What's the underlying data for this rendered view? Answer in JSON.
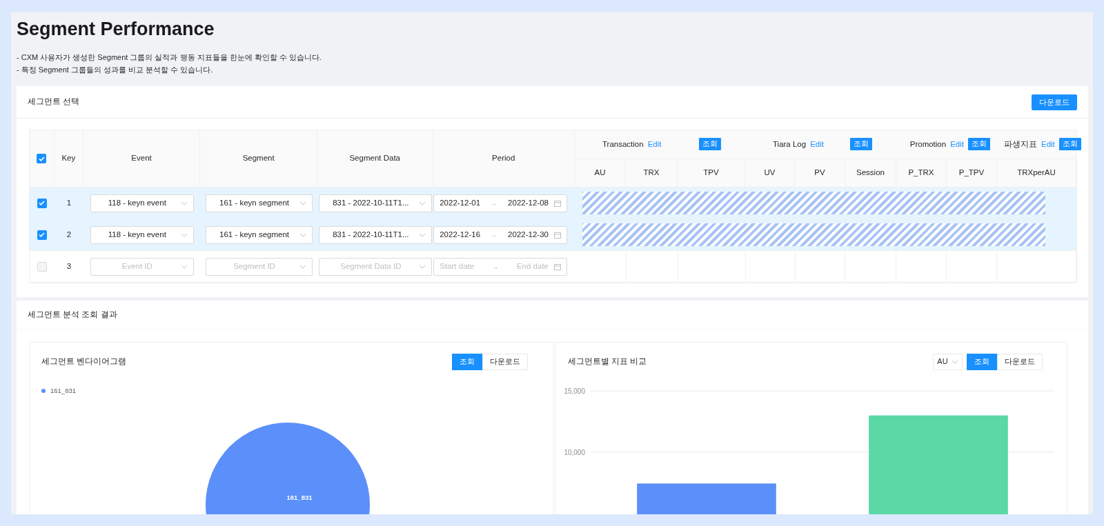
{
  "page": {
    "title": "Segment Performance",
    "description": [
      "- CXM 사용자가 생성한 Segment 그룹의 실적과 행동 지표들을 한눈에 확인할 수 있습니다.",
      "- 특정 Segment 그룹들의 성과를 비교 분석할 수 있습니다."
    ]
  },
  "selection_card": {
    "title": "세그먼트 선택",
    "download_button": "다운로드",
    "table": {
      "header_checked": true,
      "columns": [
        "Key",
        "Event",
        "Segment",
        "Segment Data",
        "Period"
      ],
      "metric_groups": [
        {
          "label": "Transaction",
          "edit": "Edit",
          "query": "조회",
          "metrics": [
            "AU",
            "TRX",
            "TPV"
          ]
        },
        {
          "label": "Tiara Log",
          "edit": "Edit",
          "query": "조회",
          "metrics": [
            "UV",
            "PV",
            "Session"
          ]
        },
        {
          "label": "Promotion",
          "edit": "Edit",
          "query": "조회",
          "metrics": [
            "P_TRX",
            "P_TPV"
          ]
        },
        {
          "label": "파생지표",
          "edit": "Edit",
          "query": "조회",
          "metrics": [
            "TRXperAU"
          ]
        }
      ],
      "rows": [
        {
          "key": "1",
          "checked": true,
          "loading": true,
          "event": {
            "value": "118 - keyn event"
          },
          "segment": {
            "value": "161 - keyn segment"
          },
          "segment_data": {
            "value": "831 - 2022-10-11T1..."
          },
          "period": {
            "separator": "→",
            "start": {
              "value": "2022-12-01"
            },
            "end": {
              "value": "2022-12-08"
            }
          }
        },
        {
          "key": "2",
          "checked": true,
          "loading": true,
          "event": {
            "value": "118 - keyn event"
          },
          "segment": {
            "value": "161 - keyn segment"
          },
          "segment_data": {
            "value": "831 - 2022-10-11T1..."
          },
          "period": {
            "separator": "→",
            "start": {
              "value": "2022-12-16"
            },
            "end": {
              "value": "2022-12-30"
            }
          }
        },
        {
          "key": "3",
          "checked": false,
          "loading": false,
          "event": {
            "placeholder": "Event ID"
          },
          "segment": {
            "placeholder": "Segment ID"
          },
          "segment_data": {
            "placeholder": "Segment Data ID"
          },
          "period": {
            "separator": "→",
            "start": {
              "placeholder": "Start date"
            },
            "end": {
              "placeholder": "End date"
            }
          }
        }
      ]
    }
  },
  "result_card": {
    "title": "세그먼트 분석 조회 결과",
    "venn_panel": {
      "title": "세그먼트 벤다이어그램",
      "buttons": [
        {
          "label": "조회",
          "selected": true
        },
        {
          "label": "다운로드",
          "selected": false
        }
      ],
      "legend": [
        {
          "label": "161_831",
          "color": "#5b8ff9"
        }
      ],
      "circle_label": "161_831"
    },
    "compare_panel": {
      "title": "세그먼트별 지표 비교",
      "metric_select": {
        "value": "AU"
      },
      "buttons": [
        {
          "label": "조회",
          "selected": true
        },
        {
          "label": "다운로드",
          "selected": false
        }
      ],
      "chart_data": {
        "type": "bar",
        "ylim": [
          0,
          15000
        ],
        "yticks": [
          {
            "value": 10000,
            "label": "10,000"
          },
          {
            "value": 15000,
            "label": "15,000"
          }
        ],
        "series": [
          {
            "color": "#5b8ff9",
            "values": [
              7450,
              null
            ]
          },
          {
            "color": "#5ad8a6",
            "values": [
              null,
              13000
            ]
          }
        ]
      }
    }
  }
}
